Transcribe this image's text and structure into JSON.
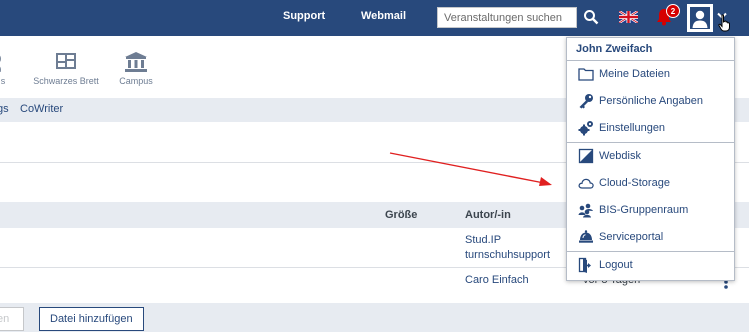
{
  "header": {
    "links": [
      "Support",
      "Webmail"
    ],
    "search_placeholder": "Veranstaltungen suchen",
    "notifications_count": "2",
    "brand_color": "#28497c",
    "icons": [
      "search-icon",
      "uk-flag-icon",
      "bell-icon",
      "avatar-icon",
      "chevron-down-icon"
    ]
  },
  "nav": {
    "items": [
      {
        "label": "s",
        "icon": "partial-icon"
      },
      {
        "label": "Schwarzes Brett",
        "icon": "bulletin-board-icon"
      },
      {
        "label": "Campus",
        "icon": "building-icon"
      }
    ]
  },
  "subtabs": [
    "gs",
    "CoWriter"
  ],
  "table": {
    "headers": {
      "size": "Größe",
      "author": "Autor/-in"
    },
    "rows": [
      {
        "author_line1": "Stud.IP",
        "author_line2": "turnschuhsupport",
        "date": ""
      },
      {
        "author_line1": "Caro Einfach",
        "author_line2": "",
        "date": "vor 8 Tagen"
      }
    ]
  },
  "footer": {
    "button_partial": "en",
    "add_file_button": "Datei hinzufügen"
  },
  "user_menu": {
    "user_name": "John Zweifach",
    "items": [
      {
        "label": "Meine Dateien",
        "icon": "folder-icon"
      },
      {
        "label": "Persönliche Angaben",
        "icon": "key-icon"
      },
      {
        "label": "Einstellungen",
        "icon": "gears-icon"
      },
      {
        "label": "Webdisk",
        "icon": "webdisk-icon"
      },
      {
        "label": "Cloud-Storage",
        "icon": "cloud-icon"
      },
      {
        "label": "BIS-Gruppenraum",
        "icon": "group-icon"
      },
      {
        "label": "Serviceportal",
        "icon": "service-portal-icon"
      },
      {
        "label": "Logout",
        "icon": "logout-icon"
      }
    ]
  }
}
